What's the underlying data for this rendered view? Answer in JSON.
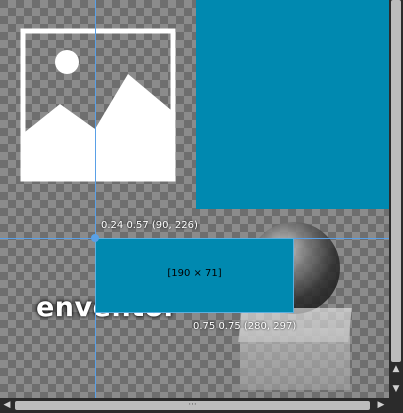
{
  "canvas": {
    "brand_text": "enventor",
    "colors": {
      "accent_blue": "#0089b0",
      "guide": "#5aa0e6",
      "checker_dark": "#6e6e6e",
      "checker_light": "#8b8b8b"
    },
    "icons": {
      "placeholder": "image-placeholder-icon",
      "sphere": "sphere-graphic",
      "cube": "cube-graphic"
    }
  },
  "guides": {
    "point_label": "0.24 0.57 (90, 226)",
    "end_label": "0.75 0.75 (280, 297)"
  },
  "selection": {
    "size_label": "[190 × 71]"
  },
  "scrollbars": {
    "up_arrow": "▲",
    "down_arrow": "▼",
    "left_arrow": "◀",
    "right_arrow": "▶",
    "grip": "···"
  }
}
